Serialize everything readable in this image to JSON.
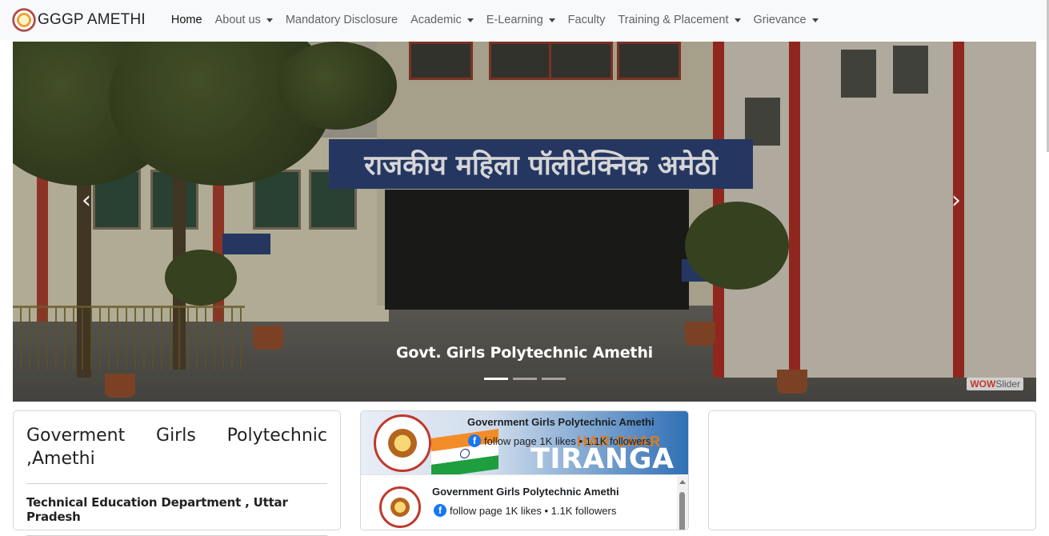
{
  "navbar": {
    "brand": "GGGP AMETHI",
    "items": [
      {
        "label": "Home",
        "dropdown": false
      },
      {
        "label": "About us",
        "dropdown": true
      },
      {
        "label": "Mandatory Disclosure",
        "dropdown": false
      },
      {
        "label": "Academic",
        "dropdown": true
      },
      {
        "label": "E-Learning",
        "dropdown": true
      },
      {
        "label": "Faculty",
        "dropdown": false
      },
      {
        "label": "Training & Placement",
        "dropdown": true
      },
      {
        "label": "Grievance",
        "dropdown": true
      }
    ]
  },
  "slider": {
    "sign_text": "राजकीय महिला पॉलीटेक्निक अमेठी",
    "caption": "Govt. Girls Polytechnic Amethi",
    "prev_icon": "chevron-left-icon",
    "next_icon": "chevron-right-icon",
    "prev_glyph": "‹",
    "next_glyph": "›",
    "indicator_count": 3,
    "active_indicator": 0,
    "watermark_a": "WOW",
    "watermark_b": "Slider"
  },
  "info_card": {
    "title_line1": "Goverment Girls Polytechnic",
    "title_line2": ",Amethi",
    "subtitle": "Technical Education Department , Uttar Pradesh"
  },
  "facebook_widget": {
    "cover_title": "Government Girls Polytechnic Amethi",
    "cover_follow": "follow page 1K likes • 1.1K followers",
    "banner_har": "HAR GHAR",
    "banner_tiranga": "TIRANGA",
    "page_name": "Government Girls Polytechnic Amethi",
    "page_follow": "follow page 1K likes • 1.1K followers",
    "fb_glyph": "f"
  },
  "colors": {
    "navbar_bg": "#f8f9fa",
    "facebook_blue": "#1877f2",
    "accent_red": "#c0392b"
  }
}
